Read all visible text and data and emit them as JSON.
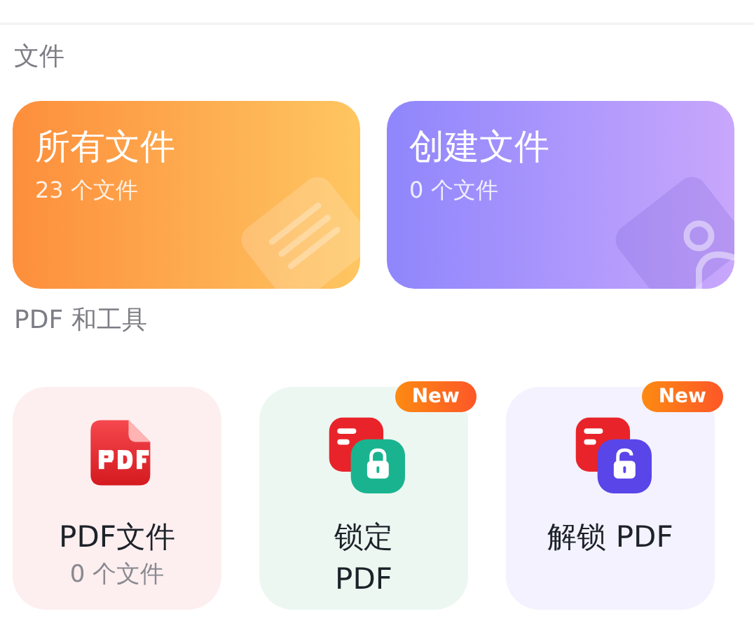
{
  "files_section": {
    "title": "文件",
    "cards": [
      {
        "kind": "document",
        "title": "所有文件",
        "subtitle": "23 个文件"
      },
      {
        "kind": "person",
        "title": "创建文件",
        "subtitle": "0 个文件"
      }
    ]
  },
  "tools_section": {
    "title": "PDF 和工具",
    "tools": [
      {
        "kind": "pdf",
        "label": "PDF文件",
        "subtitle": "0 个文件"
      },
      {
        "kind": "lock",
        "label": "锁定\nPDF",
        "badge": "New"
      },
      {
        "kind": "unlock",
        "label": "解锁 PDF",
        "badge": "New"
      }
    ]
  }
}
